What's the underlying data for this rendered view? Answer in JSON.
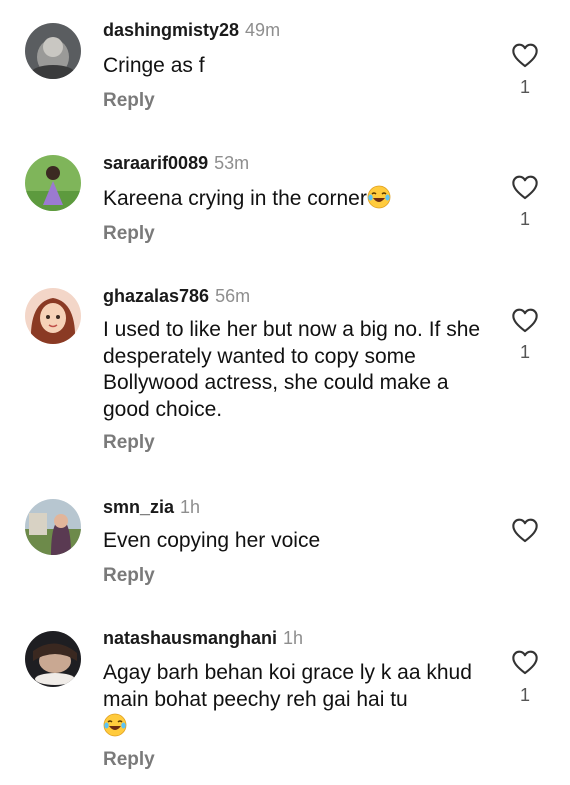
{
  "comments": [
    {
      "username": "dashingmisty28",
      "time": "49m",
      "text": "Cringe as f",
      "emoji": false,
      "reply": "Reply",
      "likes": "1"
    },
    {
      "username": "saraarif0089",
      "time": "53m",
      "text": "Kareena crying in the corner",
      "emoji": true,
      "reply": "Reply",
      "likes": "1"
    },
    {
      "username": "ghazalas786",
      "time": "56m",
      "text": "I used to like her but now a big no. If she desperately wanted to copy some Bollywood actress, she could make a good choice.",
      "emoji": false,
      "reply": "Reply",
      "likes": "1"
    },
    {
      "username": "smn_zia",
      "time": "1h",
      "text": "Even copying her voice",
      "emoji": false,
      "reply": "Reply",
      "likes": ""
    },
    {
      "username": "natashausmanghani",
      "time": "1h",
      "text": "Agay barh behan koi grace ly k aa khud main bohat peechy reh gai hai tu",
      "emoji": true,
      "reply": "Reply",
      "likes": "1"
    }
  ],
  "icons": {
    "heart": "heart-outline-icon",
    "emoji": "laughing-tears-emoji"
  }
}
